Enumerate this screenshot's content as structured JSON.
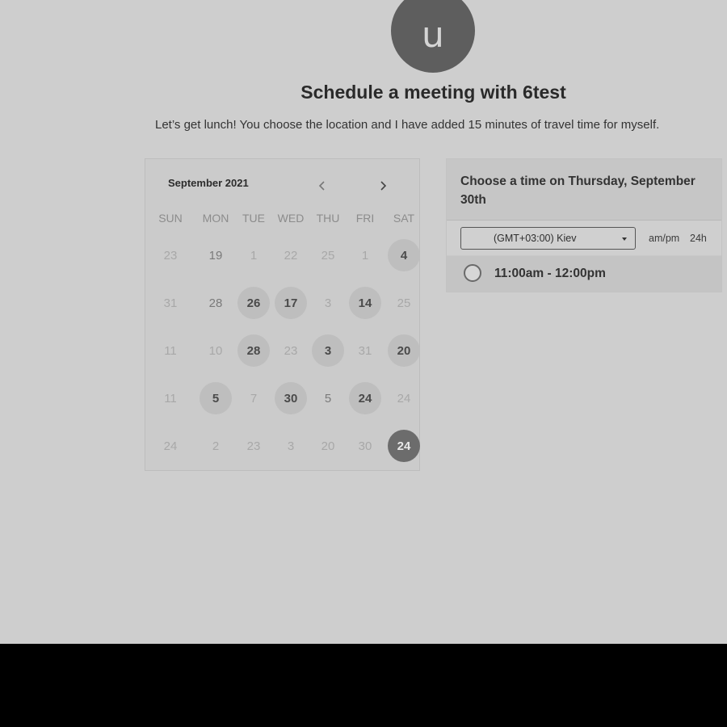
{
  "header": {
    "avatar_initial": "u",
    "title": "Schedule a meeting with 6test",
    "description": "Let’s get lunch! You choose the location and I have added 15 minutes of travel time for myself."
  },
  "calendar": {
    "month_label": "September 2021",
    "prev_icon": "chevron-left-icon",
    "next_icon": "chevron-right-icon",
    "weekdays": [
      "SUN",
      "MON",
      "TUE",
      "WED",
      "THU",
      "FRI",
      "SAT"
    ],
    "weeks": [
      [
        {
          "n": "23",
          "s": "muted"
        },
        {
          "n": "19",
          "s": "normal"
        },
        {
          "n": "1",
          "s": "muted"
        },
        {
          "n": "22",
          "s": "muted"
        },
        {
          "n": "25",
          "s": "muted"
        },
        {
          "n": "1",
          "s": "muted"
        },
        {
          "n": "4",
          "s": "available"
        }
      ],
      [
        {
          "n": "31",
          "s": "muted"
        },
        {
          "n": "28",
          "s": "normal"
        },
        {
          "n": "26",
          "s": "available"
        },
        {
          "n": "17",
          "s": "available"
        },
        {
          "n": "3",
          "s": "muted"
        },
        {
          "n": "14",
          "s": "available"
        },
        {
          "n": "25",
          "s": "muted"
        }
      ],
      [
        {
          "n": "11",
          "s": "muted"
        },
        {
          "n": "10",
          "s": "muted"
        },
        {
          "n": "28",
          "s": "available"
        },
        {
          "n": "23",
          "s": "muted"
        },
        {
          "n": "3",
          "s": "available"
        },
        {
          "n": "31",
          "s": "muted"
        },
        {
          "n": "20",
          "s": "available"
        }
      ],
      [
        {
          "n": "11",
          "s": "muted"
        },
        {
          "n": "5",
          "s": "available"
        },
        {
          "n": "7",
          "s": "muted"
        },
        {
          "n": "30",
          "s": "available"
        },
        {
          "n": "5",
          "s": "normal"
        },
        {
          "n": "24",
          "s": "available"
        },
        {
          "n": "24",
          "s": "muted"
        }
      ],
      [
        {
          "n": "24",
          "s": "muted"
        },
        {
          "n": "2",
          "s": "muted"
        },
        {
          "n": "23",
          "s": "muted"
        },
        {
          "n": "3",
          "s": "muted"
        },
        {
          "n": "20",
          "s": "muted"
        },
        {
          "n": "30",
          "s": "muted"
        },
        {
          "n": "24",
          "s": "selected"
        }
      ]
    ]
  },
  "time_panel": {
    "heading": "Choose a time on Thursday, September 30th",
    "timezone": "(GMT+03:00) Kiev",
    "format_12": "am/pm",
    "format_24": "24h",
    "slots": [
      {
        "label": "11:00am - 12:00pm",
        "selected": false
      }
    ]
  },
  "colors": {
    "background": "#cecece",
    "available_day": "#bebebe",
    "selected_day": "#6c6c6c",
    "avatar": "#5e5e5e"
  }
}
